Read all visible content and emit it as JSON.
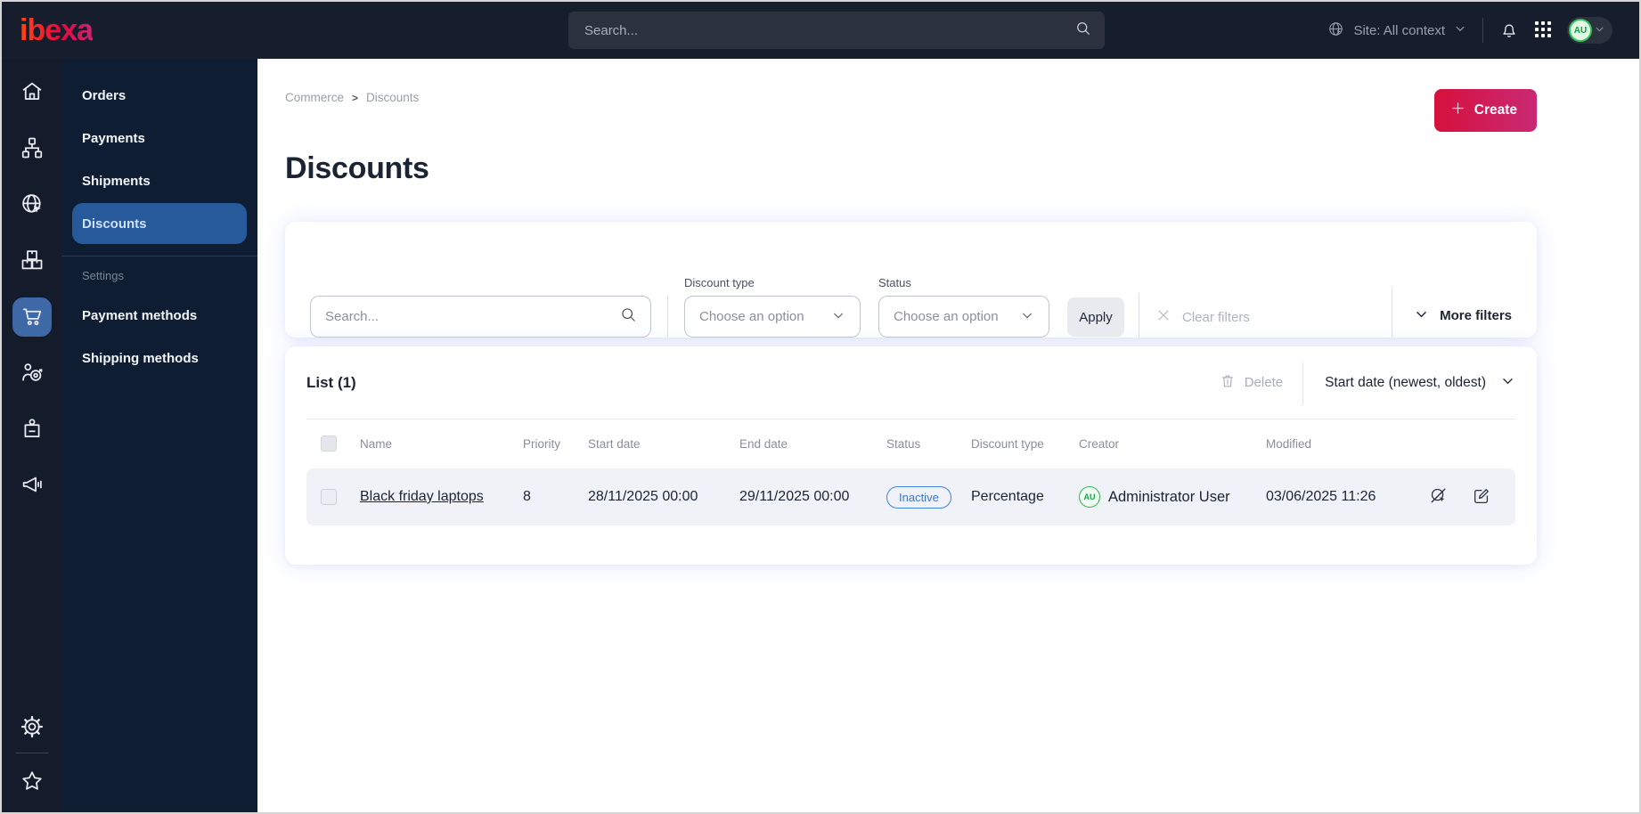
{
  "topbar": {
    "logo_text": "ibexa",
    "search_placeholder": "Search...",
    "site_selector_label": "Site: All context",
    "avatar_initials": "AU",
    "icons": [
      "globe-cursor",
      "chevron-down",
      "bell",
      "app-grid"
    ]
  },
  "rail": {
    "icons": [
      "home",
      "sitemap",
      "globe-cursor",
      "boxes",
      "shopping-cart",
      "customer-target",
      "id-badge",
      "megaphone"
    ],
    "active_icon": "shopping-cart",
    "bottom_icons": [
      "gear",
      "star"
    ]
  },
  "panel": {
    "items": [
      {
        "label": "Orders"
      },
      {
        "label": "Payments"
      },
      {
        "label": "Shipments"
      },
      {
        "label": "Discounts",
        "active": true
      }
    ],
    "section_label": "Settings",
    "settings_items": [
      {
        "label": "Payment methods"
      },
      {
        "label": "Shipping methods"
      }
    ]
  },
  "breadcrumb": {
    "items": [
      "Commerce",
      "Discounts"
    ],
    "separator": ">"
  },
  "page": {
    "title": "Discounts",
    "create_label": "Create"
  },
  "filters": {
    "search_placeholder": "Search...",
    "discount_type_label": "Discount type",
    "discount_type_value": "Choose an option",
    "status_label": "Status",
    "status_value": "Choose an option",
    "apply_label": "Apply",
    "clear_label": "Clear filters",
    "more_label": "More filters"
  },
  "list": {
    "title": "List (1)",
    "delete_label": "Delete",
    "sort_label": "Start date (newest, oldest)",
    "columns": [
      "Name",
      "Priority",
      "Start date",
      "End date",
      "Status",
      "Discount type",
      "Creator",
      "Modified"
    ],
    "rows": [
      {
        "name": "Black friday laptops",
        "priority": "8",
        "start_date": "28/11/2025 00:00",
        "end_date": "29/11/2025 00:00",
        "status": "Inactive",
        "discount_type": "Percentage",
        "creator_initials": "AU",
        "creator": "Administrator User",
        "modified": "03/06/2025 11:26",
        "action_icons": [
          "preview-disabled",
          "edit"
        ]
      }
    ]
  },
  "colors": {
    "topbar_bg": "#161d2c",
    "rail_bg": "#141b2a",
    "panel_bg": "#0f1d33",
    "active_blue": "#275a9b",
    "rail_active_blue": "#3f69a6",
    "create_gradient_start": "#d6103c",
    "create_gradient_end": "#c92a74",
    "status_badge_blue": "#4385db",
    "avatar_green": "#2fb457",
    "row_bg": "#f1f2f7"
  }
}
